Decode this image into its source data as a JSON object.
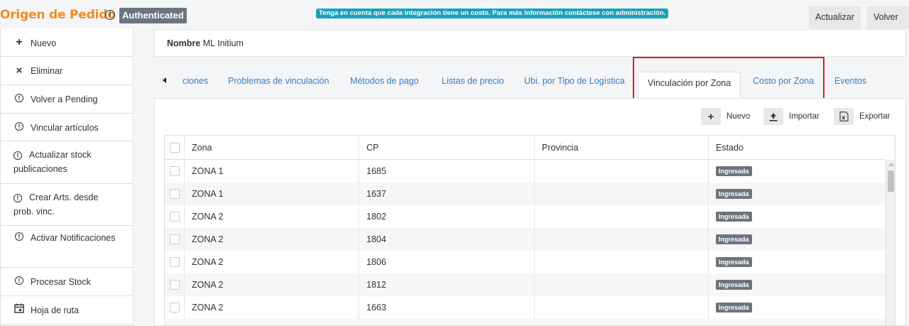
{
  "header": {
    "title": "Origen de Pedido",
    "info_icon": "info-circle",
    "auth_badge": "Authenticated",
    "notice": "Tenga en cuenta que cada integración tiene un costo. Para más información contáctese con administración.",
    "actualizar_label": "Actualizar",
    "volver_label": "Volver"
  },
  "sidebar": {
    "items": [
      {
        "icon": "+",
        "label": "Nuevo"
      },
      {
        "icon": "×",
        "label": "Eliminar"
      },
      {
        "icon": "!",
        "label": "Volver a Pending"
      },
      {
        "icon": "!",
        "label": "Vincular artículos"
      },
      {
        "icon": "!",
        "label": "Actualizar stock publicaciones"
      },
      {
        "icon": "!",
        "label": "Crear Arts. desde prob. vinc."
      },
      {
        "icon": "!",
        "label": "Activar Notificaciones"
      },
      {
        "icon": "!",
        "label": "Procesar Stock"
      },
      {
        "icon": "calendar",
        "label": "Hoja de ruta"
      }
    ]
  },
  "nombre": {
    "label": "Nombre",
    "value": "ML Initium"
  },
  "tabs": [
    {
      "label": "ciones"
    },
    {
      "label": "Problemas de vinculación"
    },
    {
      "label": "Métodos de pago"
    },
    {
      "label": "Listas de precio"
    },
    {
      "label": "Ubi. por Tipo de Logística"
    },
    {
      "label": "Vinculación por Zona",
      "active": true
    },
    {
      "label": "Costo por Zona"
    },
    {
      "label": "Eventos"
    }
  ],
  "toolbar": {
    "nuevo_label": "Nuevo",
    "importar_label": "Importar",
    "exportar_label": "Exportar"
  },
  "table": {
    "columns": [
      "Zona",
      "CP",
      "Provincia",
      "Estado"
    ],
    "rows": [
      {
        "zona": "ZONA 1",
        "cp": "1685",
        "provincia": "",
        "estado": "Ingresada"
      },
      {
        "zona": "ZONA 1",
        "cp": "1637",
        "provincia": "",
        "estado": "Ingresada"
      },
      {
        "zona": "ZONA 2",
        "cp": "1802",
        "provincia": "",
        "estado": "Ingresada"
      },
      {
        "zona": "ZONA 2",
        "cp": "1804",
        "provincia": "",
        "estado": "Ingresada"
      },
      {
        "zona": "ZONA 2",
        "cp": "1806",
        "provincia": "",
        "estado": "Ingresada"
      },
      {
        "zona": "ZONA 2",
        "cp": "1812",
        "provincia": "",
        "estado": "Ingresada"
      },
      {
        "zona": "ZONA 2",
        "cp": "1663",
        "provincia": "",
        "estado": "Ingresada"
      }
    ]
  },
  "colors": {
    "title": "#f08a24",
    "link": "#3a7bc8",
    "badge": "#6c757d",
    "notice": "#17a2b8",
    "highlight": "#e31c1c"
  }
}
